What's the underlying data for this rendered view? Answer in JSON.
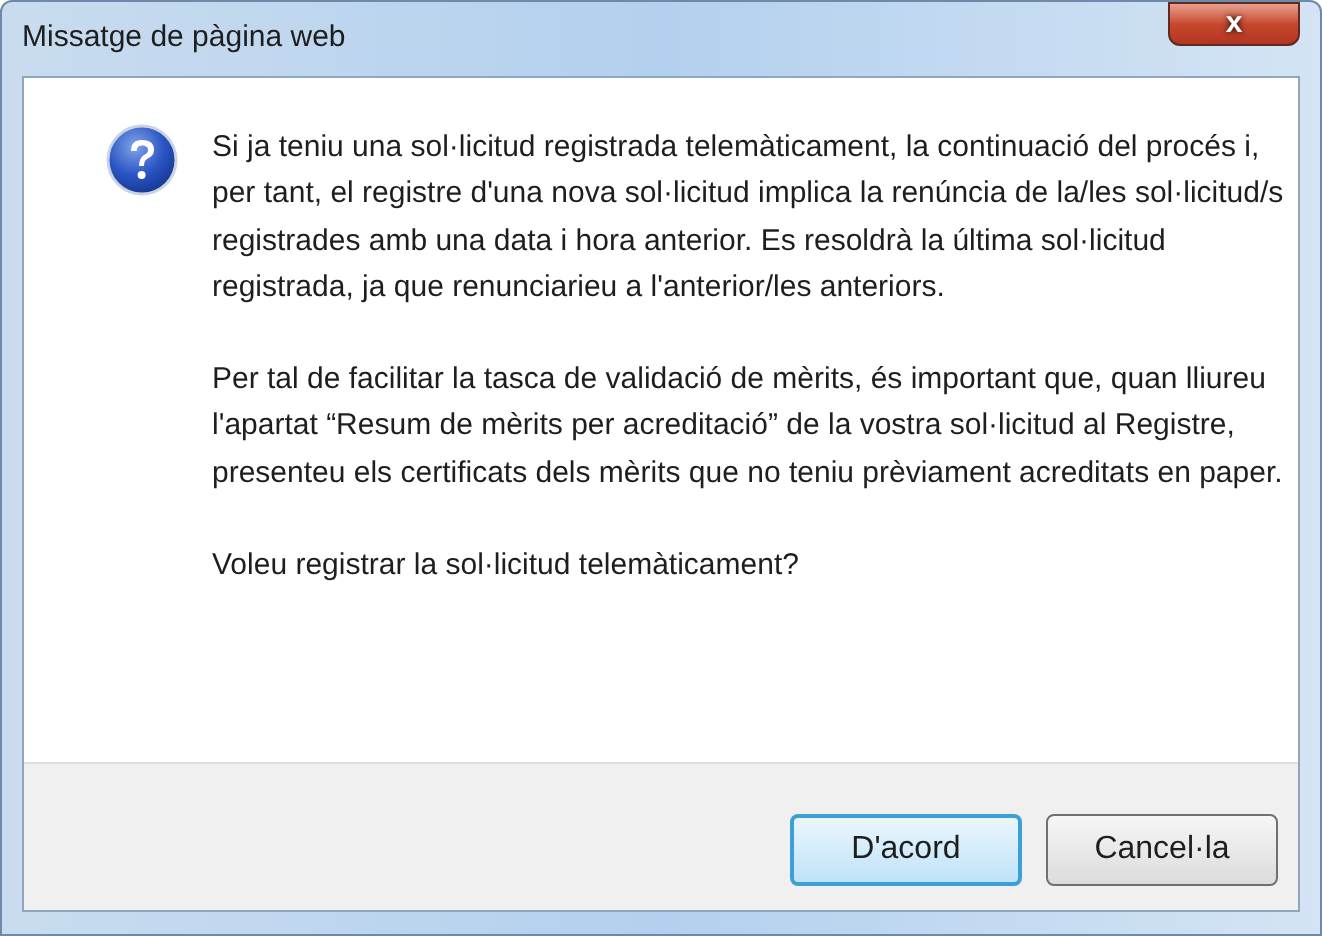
{
  "window": {
    "title": "Missatge de pàgina web",
    "close": "x"
  },
  "message": {
    "paragraphs": [
      "Si ja teniu una sol·licitud registrada telemàticament, la continuació del procés i, per tant, el registre d'una nova sol·licitud implica la renúncia de la/les sol·licitud/s registrades amb una data i hora anterior. Es resoldrà la última sol·licitud registrada, ja que renunciarieu a l'anterior/les anteriors.",
      "Per tal de facilitar la tasca de validació de mèrits, és important que, quan lliureu l'apartat “Resum de mèrits per acreditació” de la vostra sol·licitud al Registre, presenteu els certificats dels mèrits que no teniu prèviament acreditats en paper.",
      "Voleu registrar la sol·licitud telemàticament?"
    ]
  },
  "buttons": [
    {
      "label": "D'acord",
      "default": true
    },
    {
      "label": "Cancel·la",
      "default": false
    }
  ]
}
